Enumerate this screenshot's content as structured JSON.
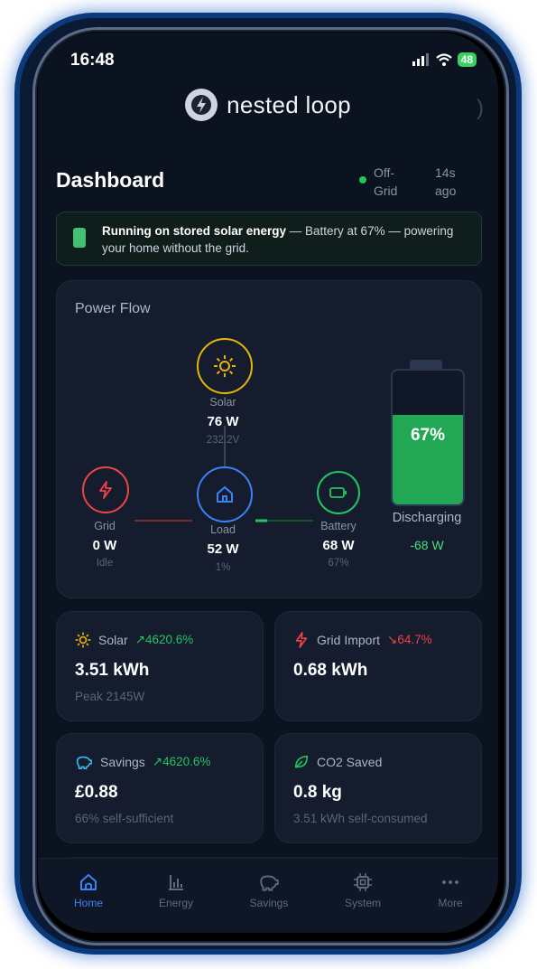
{
  "status_bar": {
    "time": "16:48",
    "battery": "48"
  },
  "brand": {
    "name": "nested loop"
  },
  "header": {
    "title": "Dashboard",
    "mode_line1": "Off-",
    "mode_line2": "Grid",
    "updated_line1": "14s",
    "updated_line2": "ago"
  },
  "banner": {
    "strong": "Running on stored solar energy",
    "text": " — Battery at 67% — powering your home without the grid."
  },
  "power_flow": {
    "title": "Power Flow",
    "solar": {
      "label": "Solar",
      "value": "76 W",
      "sub": "232.2V"
    },
    "grid": {
      "label": "Grid",
      "value": "0 W",
      "sub": "Idle"
    },
    "load": {
      "label": "Load",
      "value": "52 W",
      "sub": "1%"
    },
    "battery_node": {
      "label": "Battery",
      "value": "68 W",
      "sub": "67%"
    },
    "battery": {
      "percent_text": "67%",
      "level": 0.67,
      "state": "Discharging",
      "flow": "-68 W"
    }
  },
  "stats": [
    {
      "label": "Solar",
      "trend": "4620.6%",
      "trend_dir": "up",
      "value": "3.51 kWh",
      "sub": "Peak 2145W",
      "icon": "sun-icon"
    },
    {
      "label": "Grid Import",
      "trend": "64.7%",
      "trend_dir": "down",
      "value": "0.68 kWh",
      "sub": "",
      "icon": "bolt-icon"
    },
    {
      "label": "Savings",
      "trend": "4620.6%",
      "trend_dir": "up",
      "value": "£0.88",
      "sub": "66% self-sufficient",
      "icon": "piggy-bank-icon"
    },
    {
      "label": "CO2 Saved",
      "trend": "",
      "trend_dir": "",
      "value": "0.8 kg",
      "sub": "3.51 kWh self-consumed",
      "icon": "leaf-icon"
    }
  ],
  "tabs": [
    {
      "label": "Home",
      "active": true
    },
    {
      "label": "Energy",
      "active": false
    },
    {
      "label": "Savings",
      "active": false
    },
    {
      "label": "System",
      "active": false
    },
    {
      "label": "More",
      "active": false
    }
  ],
  "colors": {
    "accent": "#3b82f6",
    "positive": "#22c55e",
    "negative": "#ef4444",
    "solar": "#eab308",
    "battery": "#22a854",
    "grid": "#ef4444"
  }
}
